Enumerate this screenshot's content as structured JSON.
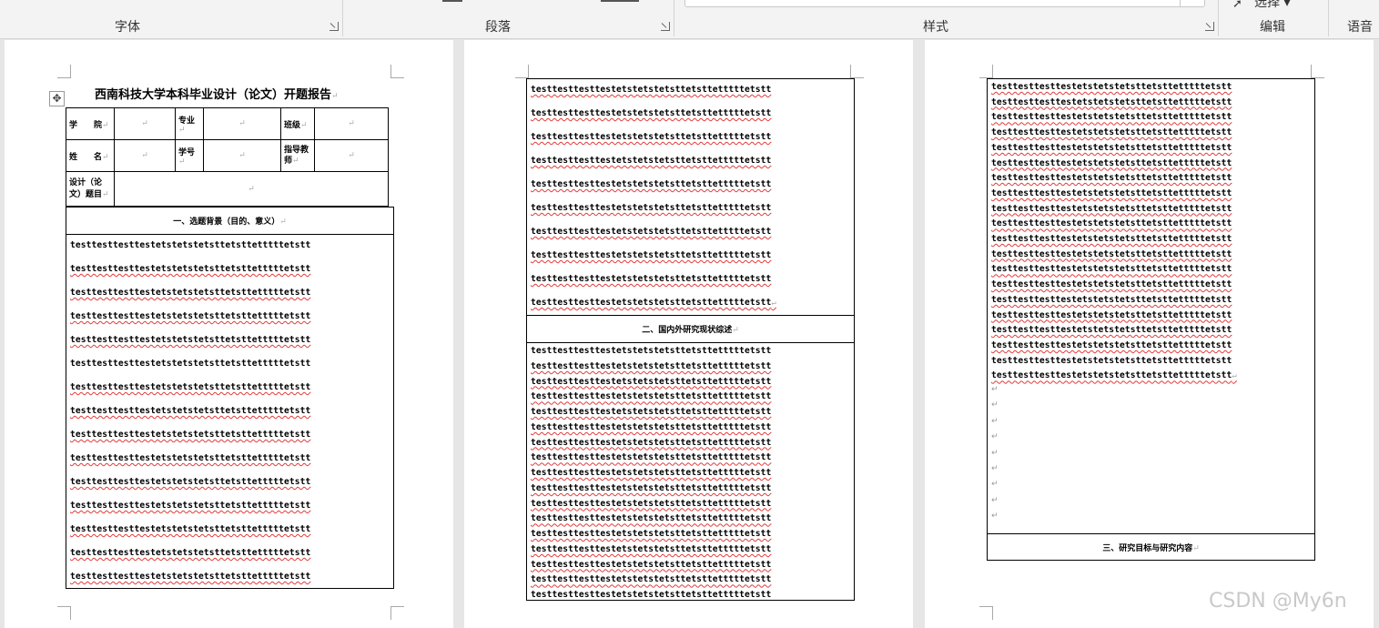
{
  "ribbon": {
    "groups": {
      "font": "字体",
      "paragraph": "段落",
      "styles": "样式",
      "editing": "编辑",
      "voice": "语音"
    },
    "select_label": "选择 ▾"
  },
  "page1": {
    "title": "西南科技大学本科毕业设计（论文）开题报告",
    "paragraph_mark": "↵",
    "table": {
      "college_label": "学　　院",
      "major_label": "专业",
      "class_label": "班级",
      "name_label": "姓　　名",
      "student_id_label": "学号",
      "advisor_label": "指导教师",
      "topic_label": "设计（论文）题目"
    },
    "section1_title": "一、选题背景（目的、意义）",
    "body_text": "testtesttesttestetstetstetsttetsttetttttetstt"
  },
  "page2": {
    "section2_title": "二、国内外研究现状综述"
  },
  "page3": {
    "section3_title": "三、研究目标与研究内容"
  },
  "watermark": "CSDN @My6n"
}
